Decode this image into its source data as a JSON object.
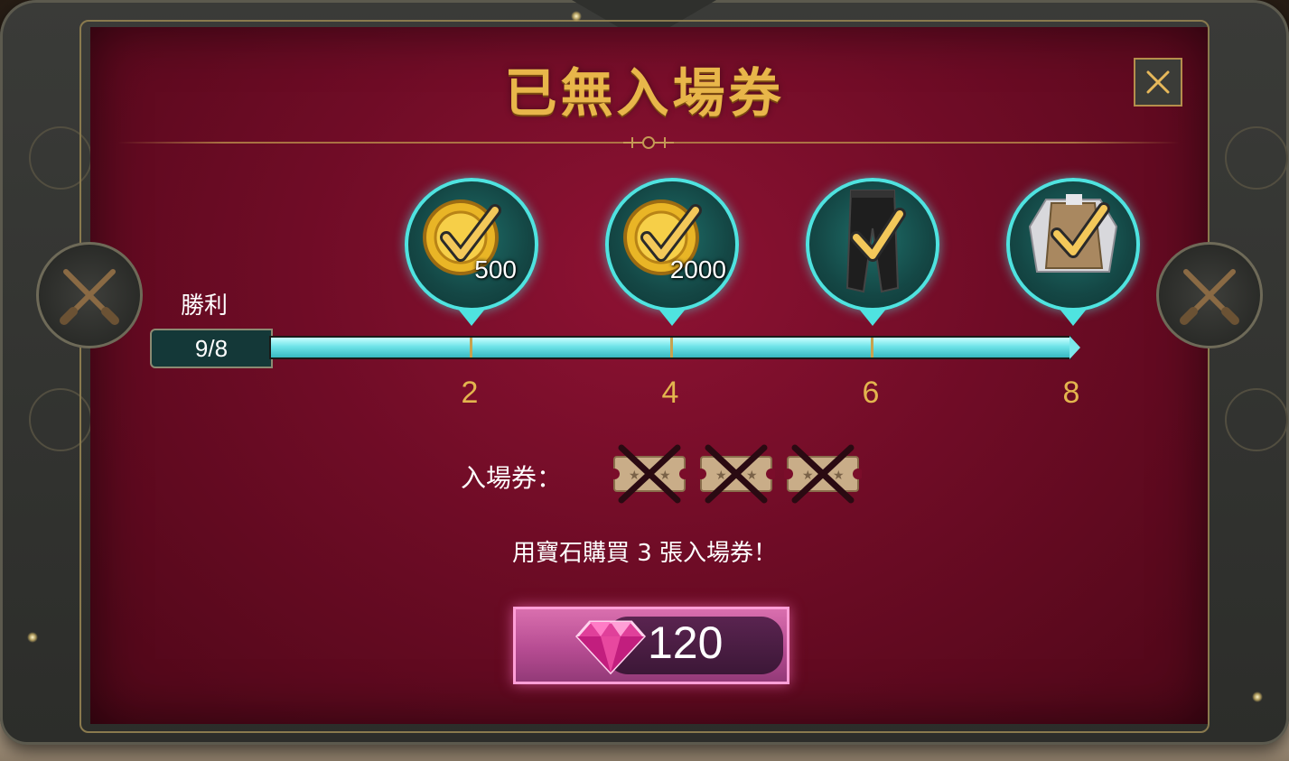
{
  "dialog": {
    "title": "已無入場券",
    "close_icon": "close-icon"
  },
  "progress": {
    "wins_label": "勝利",
    "wins_value": "9/8",
    "fill_fraction": 1.0,
    "milestones": [
      "2",
      "4",
      "6",
      "8"
    ]
  },
  "rewards": [
    {
      "icon": "gold-coin-icon",
      "amount": "500",
      "claimed": true
    },
    {
      "icon": "gold-coin-icon",
      "amount": "2000",
      "claimed": true
    },
    {
      "icon": "trousers-icon",
      "amount": "",
      "claimed": true
    },
    {
      "icon": "jacket-icon",
      "amount": "",
      "claimed": true
    }
  ],
  "tickets": {
    "label": "入場券：",
    "count": 3,
    "remaining": 0
  },
  "purchase": {
    "message": "用寶石購買 3 張入場券！",
    "price": "120",
    "currency_icon": "gem-icon"
  },
  "colors": {
    "panel": "#7a0d2a",
    "gold": "#e8b64a",
    "cyan": "#4fe3e0",
    "button_pink": "#b64c92"
  }
}
